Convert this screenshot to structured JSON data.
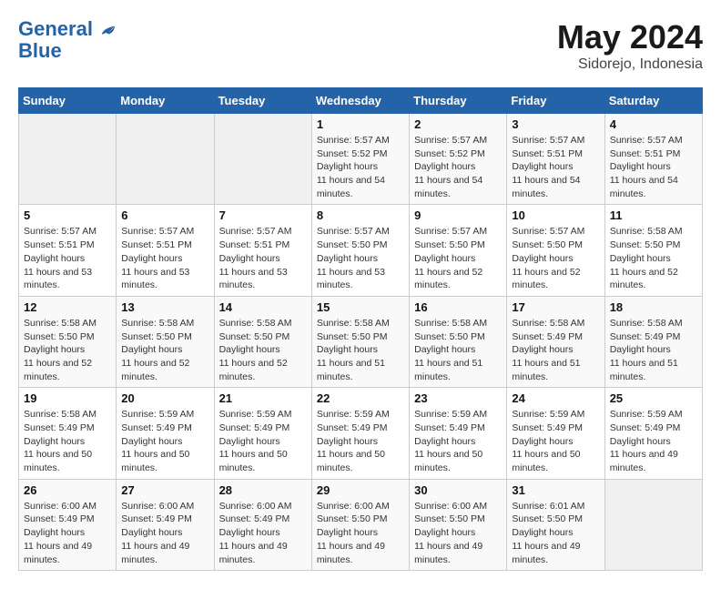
{
  "header": {
    "logo_line1": "General",
    "logo_line2": "Blue",
    "month": "May 2024",
    "location": "Sidorejo, Indonesia"
  },
  "weekdays": [
    "Sunday",
    "Monday",
    "Tuesday",
    "Wednesday",
    "Thursday",
    "Friday",
    "Saturday"
  ],
  "weeks": [
    [
      {
        "day": "",
        "empty": true
      },
      {
        "day": "",
        "empty": true
      },
      {
        "day": "",
        "empty": true
      },
      {
        "day": "1",
        "sunrise": "5:57 AM",
        "sunset": "5:52 PM",
        "daylight": "11 hours and 54 minutes."
      },
      {
        "day": "2",
        "sunrise": "5:57 AM",
        "sunset": "5:52 PM",
        "daylight": "11 hours and 54 minutes."
      },
      {
        "day": "3",
        "sunrise": "5:57 AM",
        "sunset": "5:51 PM",
        "daylight": "11 hours and 54 minutes."
      },
      {
        "day": "4",
        "sunrise": "5:57 AM",
        "sunset": "5:51 PM",
        "daylight": "11 hours and 54 minutes."
      }
    ],
    [
      {
        "day": "5",
        "sunrise": "5:57 AM",
        "sunset": "5:51 PM",
        "daylight": "11 hours and 53 minutes."
      },
      {
        "day": "6",
        "sunrise": "5:57 AM",
        "sunset": "5:51 PM",
        "daylight": "11 hours and 53 minutes."
      },
      {
        "day": "7",
        "sunrise": "5:57 AM",
        "sunset": "5:51 PM",
        "daylight": "11 hours and 53 minutes."
      },
      {
        "day": "8",
        "sunrise": "5:57 AM",
        "sunset": "5:50 PM",
        "daylight": "11 hours and 53 minutes."
      },
      {
        "day": "9",
        "sunrise": "5:57 AM",
        "sunset": "5:50 PM",
        "daylight": "11 hours and 52 minutes."
      },
      {
        "day": "10",
        "sunrise": "5:57 AM",
        "sunset": "5:50 PM",
        "daylight": "11 hours and 52 minutes."
      },
      {
        "day": "11",
        "sunrise": "5:58 AM",
        "sunset": "5:50 PM",
        "daylight": "11 hours and 52 minutes."
      }
    ],
    [
      {
        "day": "12",
        "sunrise": "5:58 AM",
        "sunset": "5:50 PM",
        "daylight": "11 hours and 52 minutes."
      },
      {
        "day": "13",
        "sunrise": "5:58 AM",
        "sunset": "5:50 PM",
        "daylight": "11 hours and 52 minutes."
      },
      {
        "day": "14",
        "sunrise": "5:58 AM",
        "sunset": "5:50 PM",
        "daylight": "11 hours and 52 minutes."
      },
      {
        "day": "15",
        "sunrise": "5:58 AM",
        "sunset": "5:50 PM",
        "daylight": "11 hours and 51 minutes."
      },
      {
        "day": "16",
        "sunrise": "5:58 AM",
        "sunset": "5:50 PM",
        "daylight": "11 hours and 51 minutes."
      },
      {
        "day": "17",
        "sunrise": "5:58 AM",
        "sunset": "5:49 PM",
        "daylight": "11 hours and 51 minutes."
      },
      {
        "day": "18",
        "sunrise": "5:58 AM",
        "sunset": "5:49 PM",
        "daylight": "11 hours and 51 minutes."
      }
    ],
    [
      {
        "day": "19",
        "sunrise": "5:58 AM",
        "sunset": "5:49 PM",
        "daylight": "11 hours and 50 minutes."
      },
      {
        "day": "20",
        "sunrise": "5:59 AM",
        "sunset": "5:49 PM",
        "daylight": "11 hours and 50 minutes."
      },
      {
        "day": "21",
        "sunrise": "5:59 AM",
        "sunset": "5:49 PM",
        "daylight": "11 hours and 50 minutes."
      },
      {
        "day": "22",
        "sunrise": "5:59 AM",
        "sunset": "5:49 PM",
        "daylight": "11 hours and 50 minutes."
      },
      {
        "day": "23",
        "sunrise": "5:59 AM",
        "sunset": "5:49 PM",
        "daylight": "11 hours and 50 minutes."
      },
      {
        "day": "24",
        "sunrise": "5:59 AM",
        "sunset": "5:49 PM",
        "daylight": "11 hours and 50 minutes."
      },
      {
        "day": "25",
        "sunrise": "5:59 AM",
        "sunset": "5:49 PM",
        "daylight": "11 hours and 49 minutes."
      }
    ],
    [
      {
        "day": "26",
        "sunrise": "6:00 AM",
        "sunset": "5:49 PM",
        "daylight": "11 hours and 49 minutes."
      },
      {
        "day": "27",
        "sunrise": "6:00 AM",
        "sunset": "5:49 PM",
        "daylight": "11 hours and 49 minutes."
      },
      {
        "day": "28",
        "sunrise": "6:00 AM",
        "sunset": "5:49 PM",
        "daylight": "11 hours and 49 minutes."
      },
      {
        "day": "29",
        "sunrise": "6:00 AM",
        "sunset": "5:50 PM",
        "daylight": "11 hours and 49 minutes."
      },
      {
        "day": "30",
        "sunrise": "6:00 AM",
        "sunset": "5:50 PM",
        "daylight": "11 hours and 49 minutes."
      },
      {
        "day": "31",
        "sunrise": "6:01 AM",
        "sunset": "5:50 PM",
        "daylight": "11 hours and 49 minutes."
      },
      {
        "day": "",
        "empty": true
      }
    ]
  ]
}
